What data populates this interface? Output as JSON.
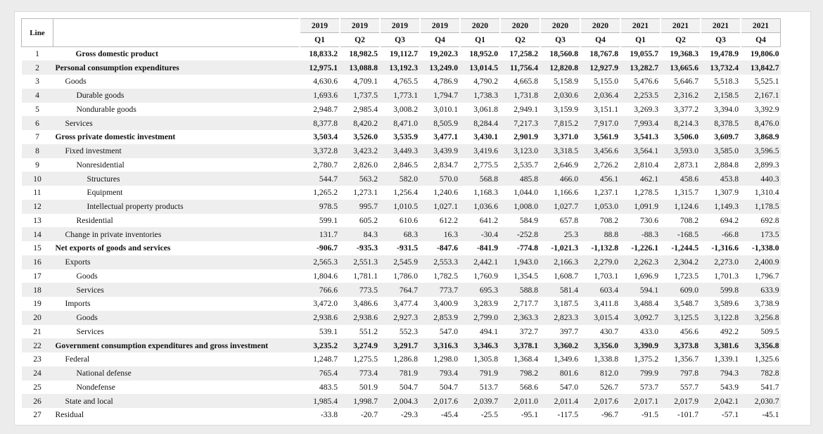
{
  "header": {
    "line_label": "Line",
    "years": [
      "2019",
      "2019",
      "2019",
      "2019",
      "2020",
      "2020",
      "2020",
      "2020",
      "2021",
      "2021",
      "2021",
      "2021"
    ],
    "quarters": [
      "Q1",
      "Q2",
      "Q3",
      "Q4",
      "Q1",
      "Q2",
      "Q3",
      "Q4",
      "Q1",
      "Q2",
      "Q3",
      "Q4"
    ]
  },
  "rows": [
    {
      "line": "1",
      "label": "Gross domestic product",
      "style": "bold center",
      "values": [
        "18,833.2",
        "18,982.5",
        "19,112.7",
        "19,202.3",
        "18,952.0",
        "17,258.2",
        "18,560.8",
        "18,767.8",
        "19,055.7",
        "19,368.3",
        "19,478.9",
        "19,806.0"
      ]
    },
    {
      "line": "2",
      "label": "Personal consumption expenditures",
      "style": "bold",
      "values": [
        "12,975.1",
        "13,088.8",
        "13,192.3",
        "13,249.0",
        "13,014.5",
        "11,756.4",
        "12,820.8",
        "12,927.9",
        "13,282.7",
        "13,665.6",
        "13,732.4",
        "13,842.7"
      ]
    },
    {
      "line": "3",
      "label": "Goods",
      "style": "ind1",
      "values": [
        "4,630.6",
        "4,709.1",
        "4,765.5",
        "4,786.9",
        "4,790.2",
        "4,665.8",
        "5,158.9",
        "5,155.0",
        "5,476.6",
        "5,646.7",
        "5,518.3",
        "5,525.1"
      ]
    },
    {
      "line": "4",
      "label": "Durable goods",
      "style": "ind2",
      "values": [
        "1,693.6",
        "1,737.5",
        "1,773.1",
        "1,794.7",
        "1,738.3",
        "1,731.8",
        "2,030.6",
        "2,036.4",
        "2,253.5",
        "2,316.2",
        "2,158.5",
        "2,167.1"
      ]
    },
    {
      "line": "5",
      "label": "Nondurable goods",
      "style": "ind2",
      "values": [
        "2,948.7",
        "2,985.4",
        "3,008.2",
        "3,010.1",
        "3,061.8",
        "2,949.1",
        "3,159.9",
        "3,151.1",
        "3,269.3",
        "3,377.2",
        "3,394.0",
        "3,392.9"
      ]
    },
    {
      "line": "6",
      "label": "Services",
      "style": "ind1",
      "values": [
        "8,377.8",
        "8,420.2",
        "8,471.0",
        "8,505.9",
        "8,284.4",
        "7,217.3",
        "7,815.2",
        "7,917.0",
        "7,993.4",
        "8,214.3",
        "8,378.5",
        "8,476.0"
      ]
    },
    {
      "line": "7",
      "label": "Gross private domestic investment",
      "style": "bold",
      "values": [
        "3,503.4",
        "3,526.0",
        "3,535.9",
        "3,477.1",
        "3,430.1",
        "2,901.9",
        "3,371.0",
        "3,561.9",
        "3,541.3",
        "3,506.0",
        "3,609.7",
        "3,868.9"
      ]
    },
    {
      "line": "8",
      "label": "Fixed investment",
      "style": "ind1",
      "values": [
        "3,372.8",
        "3,423.2",
        "3,449.3",
        "3,439.9",
        "3,419.6",
        "3,123.0",
        "3,318.5",
        "3,456.6",
        "3,564.1",
        "3,593.0",
        "3,585.0",
        "3,596.5"
      ]
    },
    {
      "line": "9",
      "label": "Nonresidential",
      "style": "ind2",
      "values": [
        "2,780.7",
        "2,826.0",
        "2,846.5",
        "2,834.7",
        "2,775.5",
        "2,535.7",
        "2,646.9",
        "2,726.2",
        "2,810.4",
        "2,873.1",
        "2,884.8",
        "2,899.3"
      ]
    },
    {
      "line": "10",
      "label": "Structures",
      "style": "ind3",
      "values": [
        "544.7",
        "563.2",
        "582.0",
        "570.0",
        "568.8",
        "485.8",
        "466.0",
        "456.1",
        "462.1",
        "458.6",
        "453.8",
        "440.3"
      ]
    },
    {
      "line": "11",
      "label": "Equipment",
      "style": "ind3",
      "values": [
        "1,265.2",
        "1,273.1",
        "1,256.4",
        "1,240.6",
        "1,168.3",
        "1,044.0",
        "1,166.6",
        "1,237.1",
        "1,278.5",
        "1,315.7",
        "1,307.9",
        "1,310.4"
      ]
    },
    {
      "line": "12",
      "label": "Intellectual property products",
      "style": "ind3",
      "values": [
        "978.5",
        "995.7",
        "1,010.5",
        "1,027.1",
        "1,036.6",
        "1,008.0",
        "1,027.7",
        "1,053.0",
        "1,091.9",
        "1,124.6",
        "1,149.3",
        "1,178.5"
      ]
    },
    {
      "line": "13",
      "label": "Residential",
      "style": "ind2",
      "values": [
        "599.1",
        "605.2",
        "610.6",
        "612.2",
        "641.2",
        "584.9",
        "657.8",
        "708.2",
        "730.6",
        "708.2",
        "694.2",
        "692.8"
      ]
    },
    {
      "line": "14",
      "label": "Change in private inventories",
      "style": "ind1",
      "values": [
        "131.7",
        "84.3",
        "68.3",
        "16.3",
        "-30.4",
        "-252.8",
        "25.3",
        "88.8",
        "-88.3",
        "-168.5",
        "-66.8",
        "173.5"
      ]
    },
    {
      "line": "15",
      "label": "Net exports of goods and services",
      "style": "bold",
      "values": [
        "-906.7",
        "-935.3",
        "-931.5",
        "-847.6",
        "-841.9",
        "-774.8",
        "-1,021.3",
        "-1,132.8",
        "-1,226.1",
        "-1,244.5",
        "-1,316.6",
        "-1,338.0"
      ]
    },
    {
      "line": "16",
      "label": "Exports",
      "style": "ind1",
      "values": [
        "2,565.3",
        "2,551.3",
        "2,545.9",
        "2,553.3",
        "2,442.1",
        "1,943.0",
        "2,166.3",
        "2,279.0",
        "2,262.3",
        "2,304.2",
        "2,273.0",
        "2,400.9"
      ]
    },
    {
      "line": "17",
      "label": "Goods",
      "style": "ind2",
      "values": [
        "1,804.6",
        "1,781.1",
        "1,786.0",
        "1,782.5",
        "1,760.9",
        "1,354.5",
        "1,608.7",
        "1,703.1",
        "1,696.9",
        "1,723.5",
        "1,701.3",
        "1,796.7"
      ]
    },
    {
      "line": "18",
      "label": "Services",
      "style": "ind2",
      "values": [
        "766.6",
        "773.5",
        "764.7",
        "773.7",
        "695.3",
        "588.8",
        "581.4",
        "603.4",
        "594.1",
        "609.0",
        "599.8",
        "633.9"
      ]
    },
    {
      "line": "19",
      "label": "Imports",
      "style": "ind1",
      "values": [
        "3,472.0",
        "3,486.6",
        "3,477.4",
        "3,400.9",
        "3,283.9",
        "2,717.7",
        "3,187.5",
        "3,411.8",
        "3,488.4",
        "3,548.7",
        "3,589.6",
        "3,738.9"
      ]
    },
    {
      "line": "20",
      "label": "Goods",
      "style": "ind2",
      "values": [
        "2,938.6",
        "2,938.6",
        "2,927.3",
        "2,853.9",
        "2,799.0",
        "2,363.3",
        "2,823.3",
        "3,015.4",
        "3,092.7",
        "3,125.5",
        "3,122.8",
        "3,256.8"
      ]
    },
    {
      "line": "21",
      "label": "Services",
      "style": "ind2",
      "values": [
        "539.1",
        "551.2",
        "552.3",
        "547.0",
        "494.1",
        "372.7",
        "397.7",
        "430.7",
        "433.0",
        "456.6",
        "492.2",
        "509.5"
      ]
    },
    {
      "line": "22",
      "label": "Government consumption expenditures and gross investment",
      "style": "bold",
      "values": [
        "3,235.2",
        "3,274.9",
        "3,291.7",
        "3,316.3",
        "3,346.3",
        "3,378.1",
        "3,360.2",
        "3,356.0",
        "3,390.9",
        "3,373.8",
        "3,381.6",
        "3,356.8"
      ]
    },
    {
      "line": "23",
      "label": "Federal",
      "style": "ind1",
      "values": [
        "1,248.7",
        "1,275.5",
        "1,286.8",
        "1,298.0",
        "1,305.8",
        "1,368.4",
        "1,349.6",
        "1,338.8",
        "1,375.2",
        "1,356.7",
        "1,339.1",
        "1,325.6"
      ]
    },
    {
      "line": "24",
      "label": "National defense",
      "style": "ind2",
      "values": [
        "765.4",
        "773.4",
        "781.9",
        "793.4",
        "791.9",
        "798.2",
        "801.6",
        "812.0",
        "799.9",
        "797.8",
        "794.3",
        "782.8"
      ]
    },
    {
      "line": "25",
      "label": "Nondefense",
      "style": "ind2",
      "values": [
        "483.5",
        "501.9",
        "504.7",
        "504.7",
        "513.7",
        "568.6",
        "547.0",
        "526.7",
        "573.7",
        "557.7",
        "543.9",
        "541.7"
      ]
    },
    {
      "line": "26",
      "label": "State and local",
      "style": "ind1",
      "values": [
        "1,985.4",
        "1,998.7",
        "2,004.3",
        "2,017.6",
        "2,039.7",
        "2,011.0",
        "2,011.4",
        "2,017.6",
        "2,017.1",
        "2,017.9",
        "2,042.1",
        "2,030.7"
      ]
    },
    {
      "line": "27",
      "label": "Residual",
      "style": "",
      "values": [
        "-33.8",
        "-20.7",
        "-29.3",
        "-45.4",
        "-25.5",
        "-95.1",
        "-117.5",
        "-96.7",
        "-91.5",
        "-101.7",
        "-57.1",
        "-45.1"
      ]
    }
  ]
}
